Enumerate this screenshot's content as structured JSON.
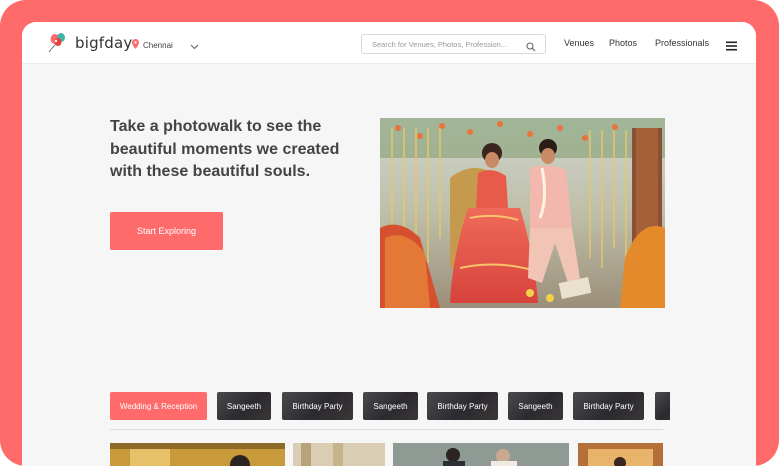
{
  "header": {
    "logo_text": "bigfday",
    "city": "Chennai",
    "search_placeholder": "Search for Venues, Photos, Profession...",
    "nav": [
      "Venues",
      "Photos",
      "Professionals"
    ]
  },
  "hero": {
    "title": "Take a photowalk to see the beautiful moments we created with these beautiful souls.",
    "cta_label": "Start Exploring"
  },
  "tabs": [
    "Wedding & Reception",
    "Sangeeth",
    "Birthday Party",
    "Sangeeth",
    "Birthday Party",
    "Sangeeth",
    "Birthday Party"
  ],
  "colors": {
    "accent": "#ff6b6b",
    "tab_dark": "#2f2d31",
    "page_bg": "#f6f6f6",
    "title_text": "#444444"
  },
  "icons": [
    "balloons-logo-icon",
    "location-pin-icon",
    "chevron-down-icon",
    "search-icon",
    "hamburger-menu-icon"
  ]
}
